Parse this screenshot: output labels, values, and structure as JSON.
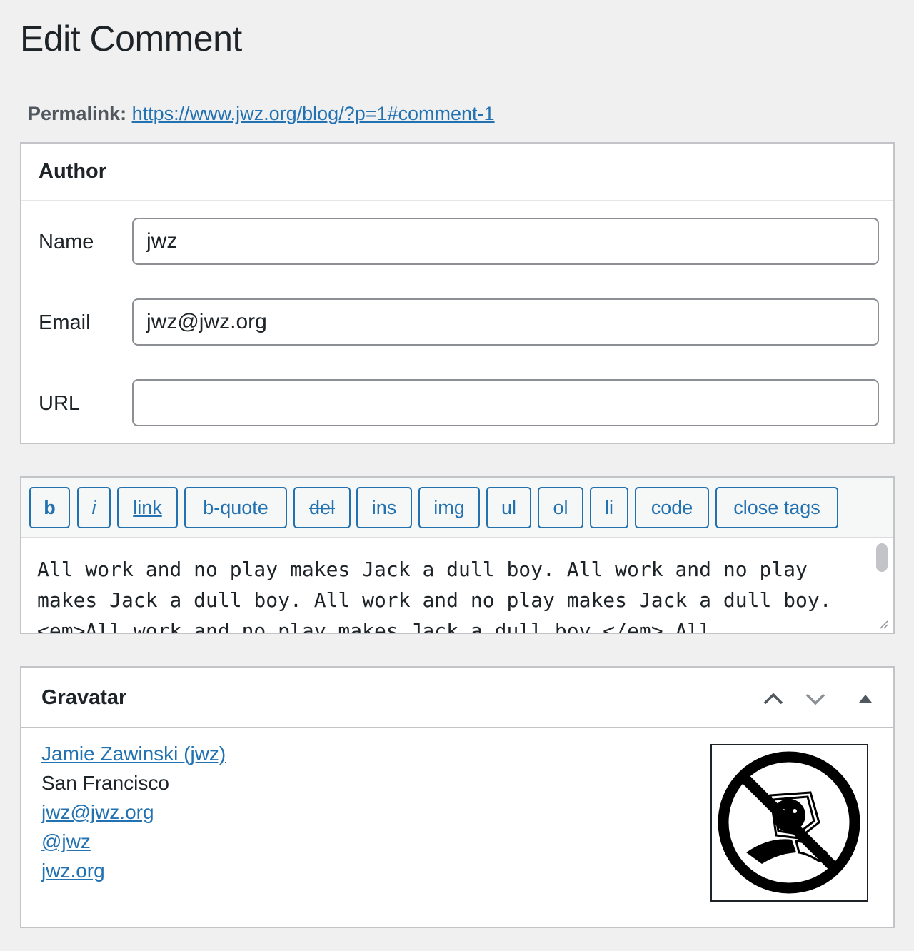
{
  "page": {
    "title": "Edit Comment"
  },
  "permalink": {
    "label": "Permalink:",
    "url": "https://www.jwz.org/blog/?p=1#comment-1"
  },
  "author": {
    "heading": "Author",
    "fields": {
      "name": {
        "label": "Name",
        "value": "jwz"
      },
      "email": {
        "label": "Email",
        "value": "jwz@jwz.org"
      },
      "url": {
        "label": "URL",
        "value": ""
      }
    }
  },
  "editor": {
    "buttons": {
      "b": "b",
      "i": "i",
      "link": "link",
      "bquote": "b-quote",
      "del": "del",
      "ins": "ins",
      "img": "img",
      "ul": "ul",
      "ol": "ol",
      "li": "li",
      "code": "code",
      "close": "close tags"
    },
    "content": "All work and no play makes Jack a dull boy. All work and no play makes Jack a dull boy. All work and no play makes Jack a dull boy. <em>All work and no play makes Jack a dull boy.</em> All"
  },
  "gravatar": {
    "heading": "Gravatar",
    "name": "Jamie Zawinski (jwz)",
    "location": "San Francisco",
    "email": "jwz@jwz.org",
    "handle": "@jwz",
    "site": "jwz.org",
    "icons": [
      "chevron-up-icon",
      "chevron-down-icon",
      "triangle-up-icon"
    ]
  },
  "colors": {
    "accent": "#2271b1",
    "background": "#f0f0f1",
    "border": "#c3c4c7"
  }
}
